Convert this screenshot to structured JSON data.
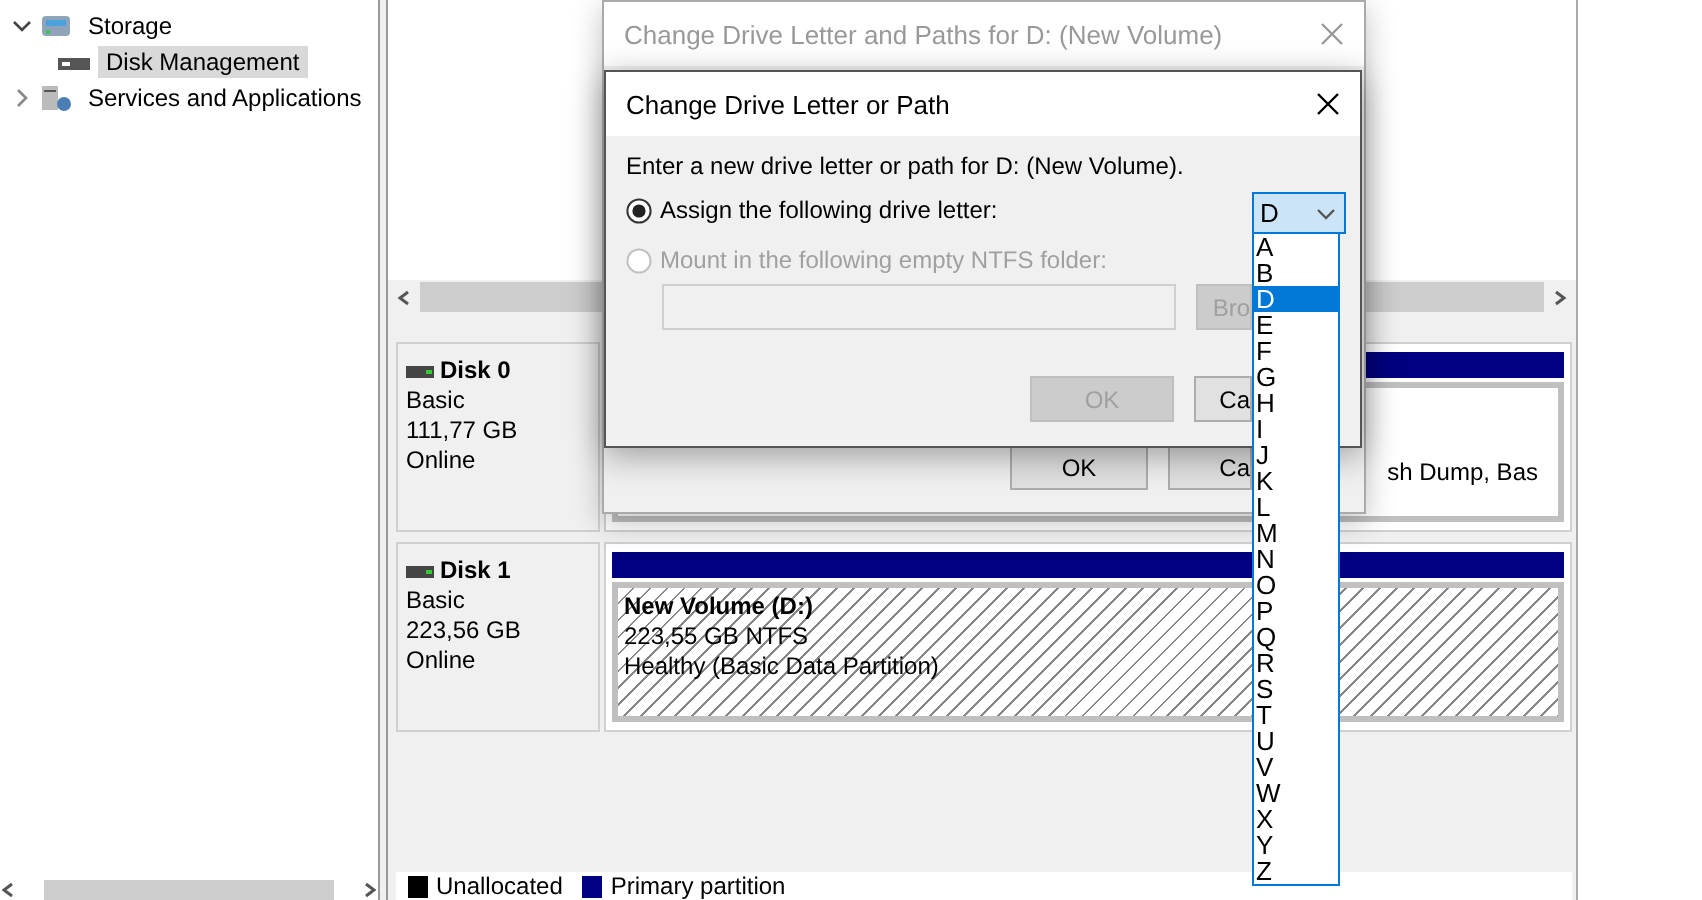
{
  "tree": [
    {
      "label": "Storage",
      "expanded": true,
      "selected": false,
      "children": [
        {
          "label": "Disk Management",
          "selected": true
        }
      ]
    },
    {
      "label": "Services and Applications",
      "expanded": false,
      "selected": false
    }
  ],
  "disks": [
    {
      "name": "Disk 0",
      "type": "Basic",
      "size": "111,77 GB",
      "status": "Online",
      "partitions": [
        {
          "selected": false,
          "lines": [
            "sh Dump, Bas"
          ]
        }
      ]
    },
    {
      "name": "Disk 1",
      "type": "Basic",
      "size": "223,56 GB",
      "status": "Online",
      "partitions": [
        {
          "selected": true,
          "title": "New Volume  (D:)",
          "lines": [
            "223,55 GB NTFS",
            "Healthy (Basic Data Partition)"
          ]
        }
      ]
    }
  ],
  "legend": [
    {
      "label": "Unallocated",
      "color": "#000000"
    },
    {
      "label": "Primary partition",
      "color": "#000080"
    }
  ],
  "outer_dialog": {
    "title": "Change Drive Letter and Paths for D: (New Volume)",
    "active": false,
    "buttons": [
      {
        "label": "OK",
        "disabled": false
      },
      {
        "label": "Ca",
        "disabled": false
      }
    ]
  },
  "inner_dialog": {
    "title": "Change Drive Letter or Path",
    "active": true,
    "prompt": "Enter a new drive letter or path for D: (New Volume).",
    "options": [
      {
        "label": "Assign the following drive letter:",
        "selected": true,
        "disabled": false
      },
      {
        "label": "Mount in the following empty NTFS folder:",
        "selected": false,
        "disabled": true
      }
    ],
    "folder_field": {
      "disabled": true
    },
    "browse_button": {
      "label": "Bro",
      "disabled": true
    },
    "buttons": [
      {
        "label": "OK",
        "disabled": true
      },
      {
        "label": "Ca",
        "disabled": false
      }
    ]
  },
  "drive_dropdown": {
    "value": "D",
    "expanded": true,
    "items": [
      {
        "label": "A",
        "selected": false
      },
      {
        "label": "B",
        "selected": false
      },
      {
        "label": "D",
        "selected": true
      },
      {
        "label": "E",
        "selected": false
      },
      {
        "label": "F",
        "selected": false
      },
      {
        "label": "G",
        "selected": false
      },
      {
        "label": "H",
        "selected": false
      },
      {
        "label": "I",
        "selected": false
      },
      {
        "label": "J",
        "selected": false
      },
      {
        "label": "K",
        "selected": false
      },
      {
        "label": "L",
        "selected": false
      },
      {
        "label": "M",
        "selected": false
      },
      {
        "label": "N",
        "selected": false
      },
      {
        "label": "O",
        "selected": false
      },
      {
        "label": "P",
        "selected": false
      },
      {
        "label": "Q",
        "selected": false
      },
      {
        "label": "R",
        "selected": false
      },
      {
        "label": "S",
        "selected": false
      },
      {
        "label": "T",
        "selected": false
      },
      {
        "label": "U",
        "selected": false
      },
      {
        "label": "V",
        "selected": false
      },
      {
        "label": "W",
        "selected": false
      },
      {
        "label": "X",
        "selected": false
      },
      {
        "label": "Y",
        "selected": false
      },
      {
        "label": "Z",
        "selected": false
      }
    ]
  }
}
